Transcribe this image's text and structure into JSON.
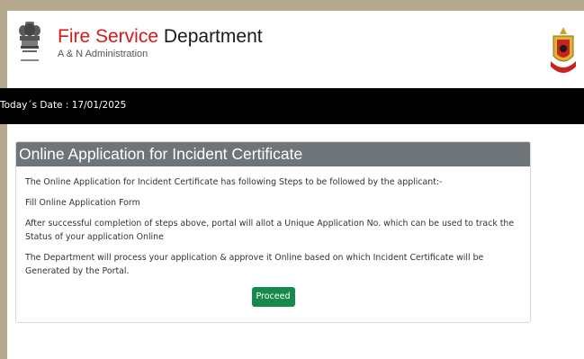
{
  "header": {
    "title_accent": "Fire Service",
    "title_rest": " Department",
    "subtitle": "A & N Administration",
    "emblem_icon": "national-emblem-icon",
    "logo_icon": "fire-service-badge-icon",
    "accent_color": "#d41a1a"
  },
  "datebar": {
    "text": "Today´s Date : 17/01/2025"
  },
  "panel": {
    "title": "Online Application for Incident Certificate",
    "paragraphs": [
      "The Online Application for Incident Certificate has following Steps to be followed by the applicant:-",
      "Fill Online Application Form",
      "After successful completion of steps above, portal will allot a Unique Application No. which can be used to track the Status of your application Online",
      "The Department will process your application & approve it Online based on which Incident Certificate will be Generated by the Portal."
    ],
    "proceed_label": "Proceed",
    "button_color": "#168a4c"
  }
}
